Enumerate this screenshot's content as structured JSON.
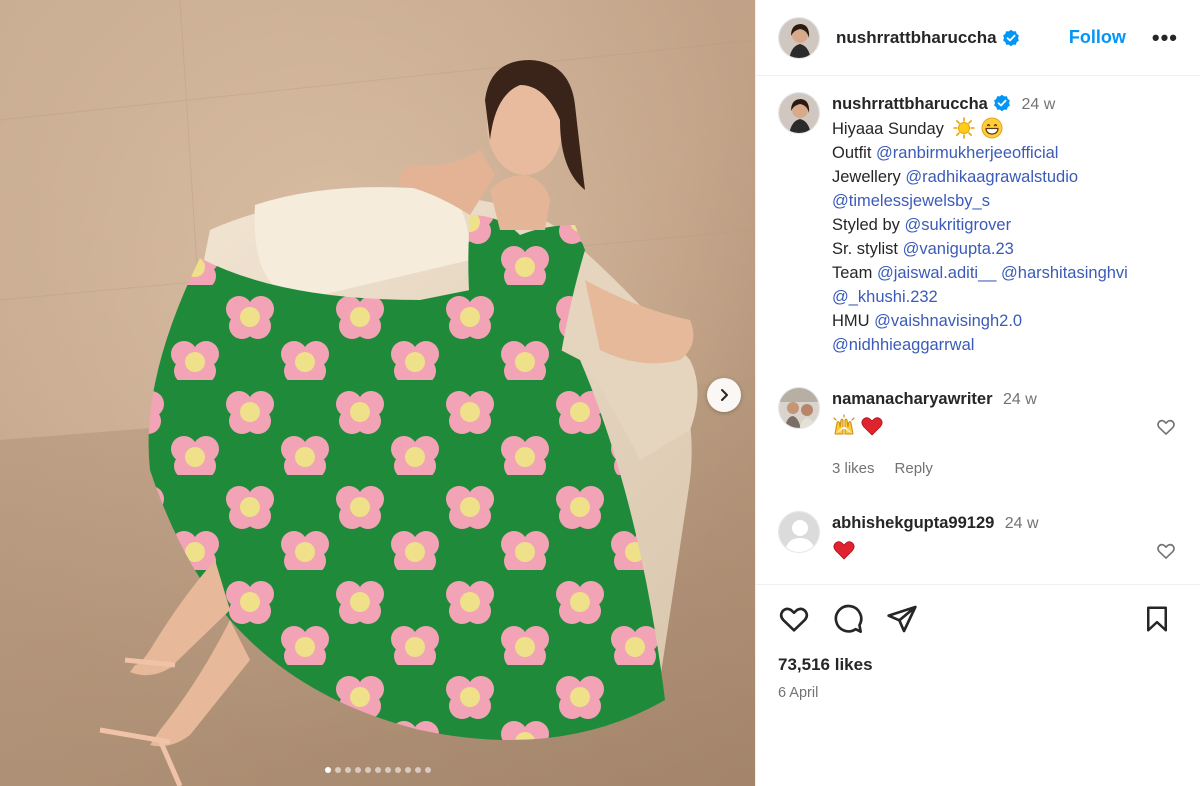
{
  "post": {
    "username": "nushrrattbharuccha",
    "follow_label": "Follow",
    "more_label": "•••"
  },
  "caption": {
    "username": "nushrrattbharuccha",
    "time": "24 w",
    "first_line": "Hiyaaa Sunday",
    "outfit_label": "Outfit",
    "outfit_mention": "@ranbirmukherjeeofficial",
    "jewellery_label": "Jewellery",
    "jewellery_mention_1": "@radhikaagrawalstudio",
    "jewellery_mention_2": "@timelessjewelsby_s",
    "styled_label": "Styled by",
    "styled_mention": "@sukritigrover",
    "stylist_label": "Sr. stylist",
    "stylist_mention": "@vanigupta.23",
    "team_label": "Team",
    "team_mention_1": "@jaiswal.aditi__",
    "team_mention_2": "@harshitasinghvi",
    "team_mention_3": "@_khushi.232",
    "hmu_label": "HMU",
    "hmu_mention_1": "@vaishnavisingh2.0",
    "hmu_mention_2": "@nidhhieaggarrwal"
  },
  "comments": [
    {
      "username": "namanacharyawriter",
      "time": "24 w",
      "likes": "3 likes",
      "reply": "Reply"
    },
    {
      "username": "abhishekgupta99129",
      "time": "24 w"
    }
  ],
  "footer": {
    "likes": "73,516 likes",
    "date": "6 April"
  },
  "carousel": {
    "slides": 11,
    "active_index": 0
  },
  "colors": {
    "accent": "#0095f6",
    "verified": "#0095f6",
    "like_red": "#ed4956"
  }
}
